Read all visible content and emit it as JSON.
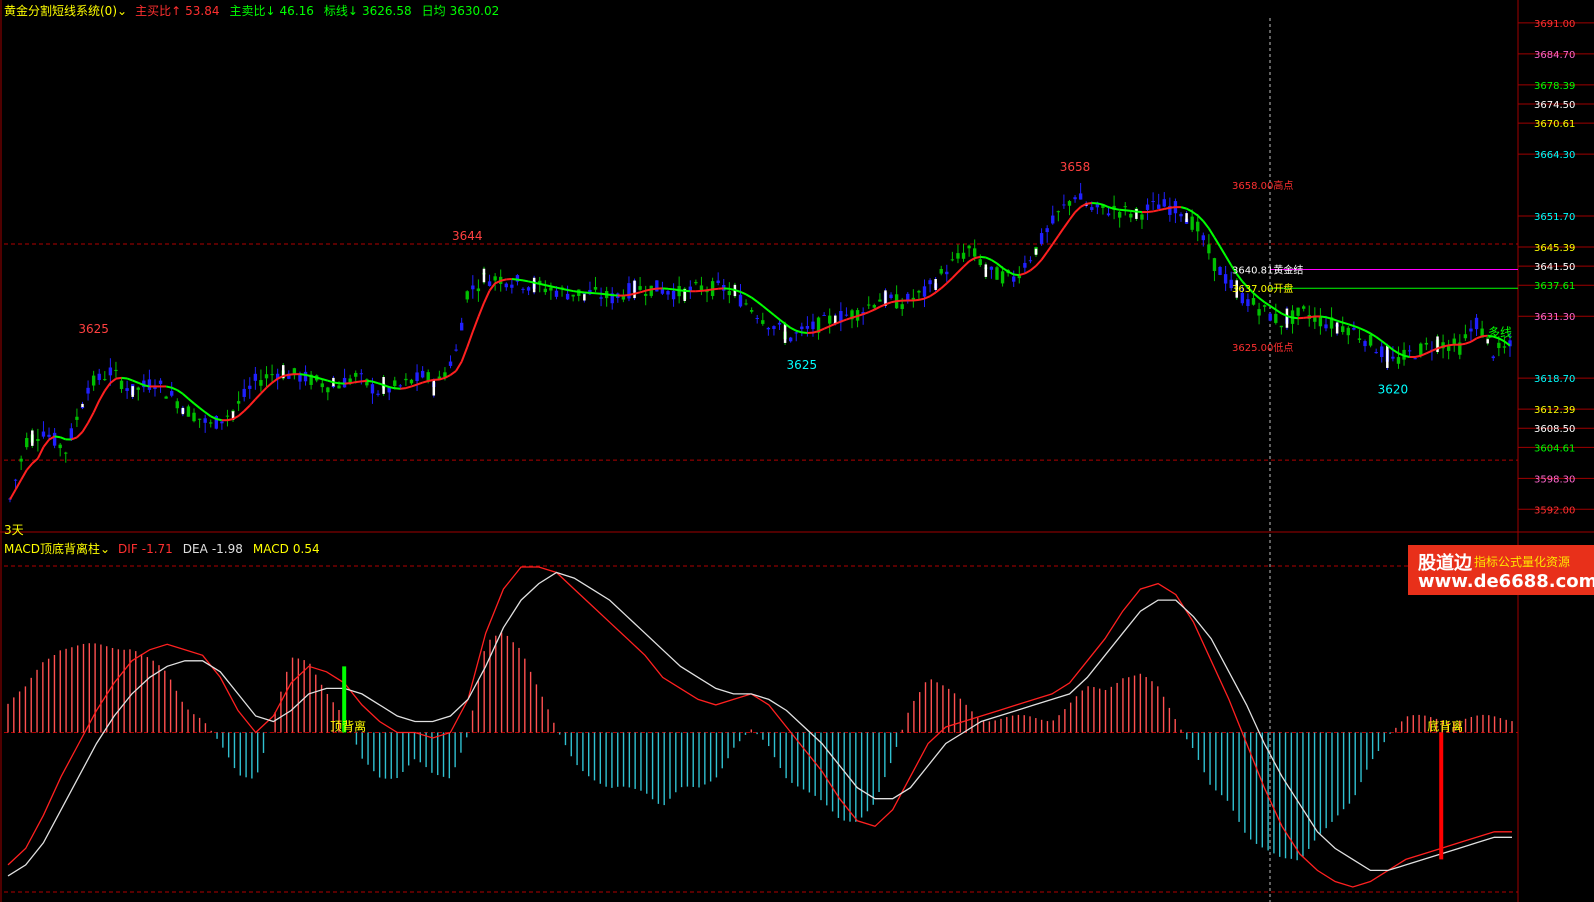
{
  "header": {
    "indicator_name": "黄金分割短线系统(0)",
    "buy_label": "主买比↑",
    "buy_value": "53.84",
    "sell_label": "主卖比↓",
    "sell_value": "46.16",
    "mark_label": "标线↓",
    "mark_value": "3626.58",
    "avg_label": "日均",
    "avg_value": "3630.02"
  },
  "period_label": "3天",
  "macd_header": {
    "name": "MACD顶底背离柱",
    "dif_label": "DIF",
    "dif_value": "-1.71",
    "dea_label": "DEA",
    "dea_value": "-1.98",
    "macd_label": "MACD",
    "macd_value": "0.54"
  },
  "watermark": {
    "brand": "股道边",
    "tagline": "指标公式量化资源",
    "url": "www.de6688.com"
  },
  "colors": {
    "background": "#000000",
    "up_candle": "#2020ff",
    "down_candle": "#00c000",
    "rising_line": "#ff2020",
    "falling_line": "#00ff00",
    "dif_line": "#ff2020",
    "dea_line": "#e0e0e0",
    "macd_positive": "#ff5050",
    "macd_negative": "#30c0d0",
    "grid": "#b00000"
  },
  "chart_data": [
    {
      "type": "candlestick",
      "title": "黄金分割短线系统(0)",
      "ylim": [
        3589,
        3692
      ],
      "y_ticks": [
        {
          "value": 3691.0,
          "label": "3691.00",
          "color": "#ff3030"
        },
        {
          "value": 3684.7,
          "label": "3684.70",
          "color": "#ff66cc"
        },
        {
          "value": 3678.39,
          "label": "3678.39",
          "color": "#00ff00"
        },
        {
          "value": 3674.5,
          "label": "3674.50",
          "color": "#ffffff"
        },
        {
          "value": 3670.61,
          "label": "3670.61",
          "color": "#ffff00"
        },
        {
          "value": 3664.3,
          "label": "3664.30",
          "color": "#00ffff"
        },
        {
          "value": 3651.7,
          "label": "3651.70",
          "color": "#00ffff"
        },
        {
          "value": 3645.39,
          "label": "3645.39",
          "color": "#ffff00"
        },
        {
          "value": 3641.5,
          "label": "3641.50",
          "color": "#ffffff"
        },
        {
          "value": 3637.61,
          "label": "3637.61",
          "color": "#00ff00"
        },
        {
          "value": 3631.3,
          "label": "3631.30",
          "color": "#ff66cc"
        },
        {
          "value": 3618.7,
          "label": "3618.70",
          "color": "#00ffff"
        },
        {
          "value": 3612.39,
          "label": "3612.39",
          "color": "#ffff00"
        },
        {
          "value": 3608.5,
          "label": "3608.50",
          "color": "#ffffff"
        },
        {
          "value": 3604.61,
          "label": "3604.61",
          "color": "#00ff00"
        },
        {
          "value": 3598.3,
          "label": "3598.30",
          "color": "#ff66cc"
        },
        {
          "value": 3592.0,
          "label": "3592.00",
          "color": "#ff3030"
        }
      ],
      "peak_labels": [
        {
          "index": 15,
          "value": 3625,
          "label": "3625",
          "pos": "above",
          "color": "#ff4040"
        },
        {
          "index": 82,
          "value": 3644,
          "label": "3644",
          "pos": "above",
          "color": "#ff4040"
        },
        {
          "index": 142,
          "value": 3625,
          "label": "3625",
          "pos": "below",
          "color": "#00ffff"
        },
        {
          "index": 191,
          "value": 3658,
          "label": "3658",
          "pos": "above",
          "color": "#ff4040"
        },
        {
          "index": 248,
          "value": 3620,
          "label": "3620",
          "pos": "below",
          "color": "#00ffff"
        }
      ],
      "level_annotations": [
        {
          "value": 3658.0,
          "label": "3658.00高点",
          "color": "#ff3030"
        },
        {
          "value": 3640.81,
          "label": "3640.81黄金结",
          "color": "#ffffff",
          "line_color": "#ff00ff"
        },
        {
          "value": 3637.0,
          "label": "3637.00开盘",
          "color": "#ffff00",
          "line_color": "#00ff00"
        },
        {
          "value": 3625.0,
          "label": "3625.00低点",
          "color": "#ff3030"
        }
      ],
      "right_tag": "多线",
      "n_bars": 270,
      "ohlc_path": [
        [
          0,
          3594
        ],
        [
          3,
          3606
        ],
        [
          6,
          3608
        ],
        [
          10,
          3604
        ],
        [
          14,
          3617
        ],
        [
          18,
          3620
        ],
        [
          22,
          3616
        ],
        [
          26,
          3618
        ],
        [
          32,
          3612
        ],
        [
          36,
          3609
        ],
        [
          40,
          3612
        ],
        [
          44,
          3618
        ],
        [
          48,
          3620
        ],
        [
          52,
          3619
        ],
        [
          58,
          3617
        ],
        [
          62,
          3619
        ],
        [
          66,
          3616
        ],
        [
          70,
          3617
        ],
        [
          74,
          3619
        ],
        [
          77,
          3618
        ],
        [
          80,
          3624
        ],
        [
          82,
          3636
        ],
        [
          85,
          3639
        ],
        [
          88,
          3639
        ],
        [
          92,
          3638
        ],
        [
          96,
          3637
        ],
        [
          100,
          3636
        ],
        [
          104,
          3636
        ],
        [
          108,
          3635
        ],
        [
          112,
          3637
        ],
        [
          116,
          3637
        ],
        [
          120,
          3636
        ],
        [
          124,
          3637
        ],
        [
          128,
          3637
        ],
        [
          132,
          3634
        ],
        [
          136,
          3630
        ],
        [
          140,
          3627
        ],
        [
          144,
          3629
        ],
        [
          148,
          3631
        ],
        [
          152,
          3632
        ],
        [
          156,
          3635
        ],
        [
          160,
          3634
        ],
        [
          164,
          3636
        ],
        [
          168,
          3641
        ],
        [
          172,
          3645
        ],
        [
          176,
          3640
        ],
        [
          180,
          3639
        ],
        [
          184,
          3645
        ],
        [
          188,
          3652
        ],
        [
          191,
          3656
        ],
        [
          194,
          3653
        ],
        [
          198,
          3653
        ],
        [
          202,
          3652
        ],
        [
          206,
          3654
        ],
        [
          210,
          3653
        ],
        [
          213,
          3649
        ],
        [
          216,
          3642
        ],
        [
          220,
          3636
        ],
        [
          224,
          3633
        ],
        [
          228,
          3630
        ],
        [
          232,
          3632
        ],
        [
          236,
          3630
        ],
        [
          240,
          3629
        ],
        [
          244,
          3626
        ],
        [
          248,
          3622
        ],
        [
          252,
          3624
        ],
        [
          256,
          3626
        ],
        [
          260,
          3625
        ],
        [
          263,
          3630
        ],
        [
          266,
          3624
        ],
        [
          269,
          3625
        ]
      ]
    },
    {
      "type": "line",
      "title": "MACD顶底背离柱",
      "series": [
        {
          "name": "DIF",
          "values": [
            -24,
            -21,
            -15,
            -8,
            -2,
            4,
            9,
            13,
            15,
            16,
            15,
            14,
            10,
            4,
            0,
            3,
            9,
            12,
            11,
            9,
            5,
            2,
            0,
            0,
            -1,
            0,
            6,
            18,
            26,
            30,
            30,
            29,
            26,
            23,
            20,
            17,
            14,
            10,
            8,
            6,
            5,
            6,
            7,
            5,
            1,
            -3,
            -7,
            -12,
            -16,
            -17,
            -14,
            -8,
            -2,
            1,
            2,
            3,
            4,
            5,
            6,
            7,
            9,
            13,
            17,
            22,
            26,
            27,
            25,
            20,
            13,
            6,
            -2,
            -10,
            -17,
            -22,
            -25,
            -27,
            -28,
            -27,
            -25,
            -23,
            -22,
            -21,
            -20,
            -19,
            -18,
            -18
          ]
        },
        {
          "name": "DEA",
          "values": [
            -26,
            -24,
            -20,
            -14,
            -8,
            -2,
            3,
            7,
            10,
            12,
            13,
            13,
            11,
            7,
            3,
            2,
            4,
            7,
            8,
            8,
            7,
            5,
            3,
            2,
            2,
            3,
            6,
            12,
            19,
            24,
            27,
            29,
            28,
            26,
            24,
            21,
            18,
            15,
            12,
            10,
            8,
            7,
            7,
            6,
            4,
            1,
            -2,
            -6,
            -10,
            -12,
            -12,
            -10,
            -6,
            -2,
            0,
            2,
            3,
            4,
            5,
            6,
            7,
            10,
            14,
            18,
            22,
            24,
            24,
            21,
            17,
            11,
            5,
            -2,
            -8,
            -13,
            -18,
            -21,
            -23,
            -25,
            -25,
            -24,
            -23,
            -22,
            -21,
            -20,
            -19,
            -19
          ]
        }
      ],
      "histogram_sign_changes": [
        "+",
        "-",
        "+",
        "-",
        "+",
        "-",
        "+",
        "-"
      ],
      "annotations": [
        {
          "label": "顶背离",
          "color": "#ffff00",
          "bar_color": "#00ff00"
        },
        {
          "label": "底背离",
          "color": "#ffff00",
          "bar_color": "#ff0000"
        }
      ]
    }
  ]
}
